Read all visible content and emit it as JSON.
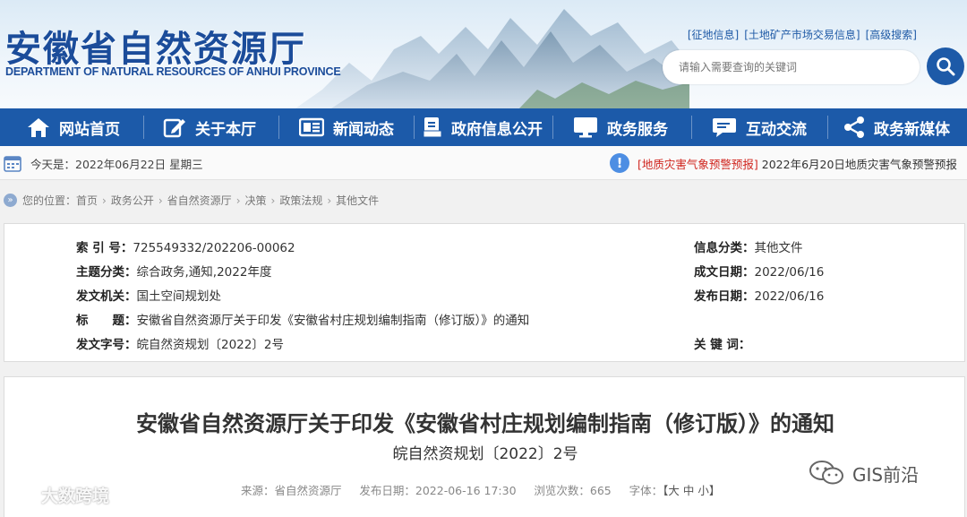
{
  "header": {
    "logo_cn": "安徽省自然资源厅",
    "logo_en": "DEPARTMENT OF NATURAL RESOURCES OF ANHUI PROVINCE",
    "top_links": [
      "[征地信息]",
      "[土地矿产市场交易信息]",
      "[高级搜索]"
    ],
    "search_placeholder": "请输入需要查询的关键词"
  },
  "nav": {
    "items": [
      {
        "label": "网站首页",
        "icon": "home-icon"
      },
      {
        "label": "关于本厅",
        "icon": "edit-icon"
      },
      {
        "label": "新闻动态",
        "icon": "news-icon"
      },
      {
        "label": "政府信息公开",
        "icon": "document-icon"
      },
      {
        "label": "政务服务",
        "icon": "monitor-icon"
      },
      {
        "label": "互动交流",
        "icon": "chat-icon"
      },
      {
        "label": "政务新媒体",
        "icon": "share-icon"
      }
    ]
  },
  "datebar": {
    "today": "今天是：2022年06月22日 星期三",
    "warning_tag": "[地质灾害气象预警预报]",
    "warning_text": "2022年6月20日地质灾害气象预警预报"
  },
  "breadcrumb": {
    "prefix": "您的位置：",
    "items": [
      "首页",
      "政务公开",
      "省自然资源厅",
      "决策",
      "政策法规",
      "其他文件"
    ]
  },
  "info": {
    "index_key": "索 引 号：",
    "index_val": "725549332/202206-00062",
    "topic_key": "主题分类：",
    "topic_val": "综合政务,通知,2022年度",
    "issuer_key": "发文机关：",
    "issuer_val": "国土空间规划处",
    "title_key": "标　　题：",
    "title_val": "安徽省自然资源厅关于印发《安徽省村庄规划编制指南（修订版）》的通知",
    "docno_key": "发文字号：",
    "docno_val": "皖自然资规划〔2022〕2号",
    "category_key": "信息分类：",
    "category_val": "其他文件",
    "created_key": "成文日期：",
    "created_val": "2022/06/16",
    "published_key": "发布日期：",
    "published_val": "2022/06/16",
    "keywords_key": "关 键 词：",
    "keywords_val": ""
  },
  "article": {
    "title": "安徽省自然资源厅关于印发《安徽省村庄规划编制指南（修订版）》的通知",
    "doc_number": "皖自然资规划〔2022〕2号",
    "source": "来源：省自然资源厅",
    "publish_date": "发布日期：2022-06-16 17:30",
    "views": "浏览次数：665",
    "font_label": "字体：",
    "font_sizes": "【大 中 小】"
  },
  "watermarks": {
    "left": "大数跨境",
    "right": "GIS前沿"
  },
  "colors": {
    "nav_bg": "#1c5aa9",
    "brand_blue": "#1b4c9a",
    "warning_red": "#d0261f"
  }
}
